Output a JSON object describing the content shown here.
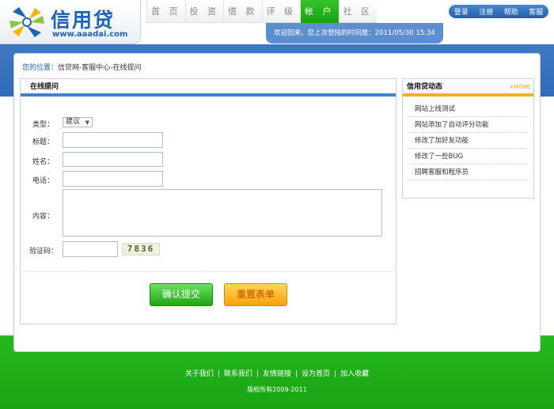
{
  "header": {
    "logo_text": "信用贷",
    "logo_url": "www.aaadai.com",
    "nav": [
      "首 页",
      "投 资",
      "借 款",
      "评 级",
      "帐 户",
      "社 区"
    ],
    "active_nav": "帐 户",
    "top_links": [
      "登录",
      "注册",
      "帮助",
      "客服"
    ],
    "welcome": "欢迎回来，您上次登陆的时间是：2011/05/30 15:34"
  },
  "breadcrumb": {
    "label": "您的位置：",
    "path": "信贷网-客服中心-在线提问"
  },
  "form": {
    "title": "在线提问",
    "type_label": "类型：",
    "type_value": "建议",
    "title_label": "标题：",
    "name_label": "姓名：",
    "phone_label": "电话：",
    "content_label": "内容：",
    "captcha_label": "验证码：",
    "captcha_text": "7836",
    "submit_label": "确认提交",
    "reset_label": "重置表单"
  },
  "news": {
    "title": "信用贷动态",
    "more": "+MORE",
    "items": [
      "网站上线测试",
      "网站添加了自动评分功能",
      "修改了加好友功能",
      "修改了一些BUG",
      "招聘客服和程序员"
    ]
  },
  "footer": {
    "links": [
      "关于我们",
      "联系我们",
      "友情链接",
      "设为首页",
      "加入收藏"
    ],
    "copyright": "版权所有2009-2011"
  },
  "colors": {
    "brand_blue": "#1f63b5",
    "accent_green": "#16a30f",
    "accent_orange": "#f5b021"
  }
}
